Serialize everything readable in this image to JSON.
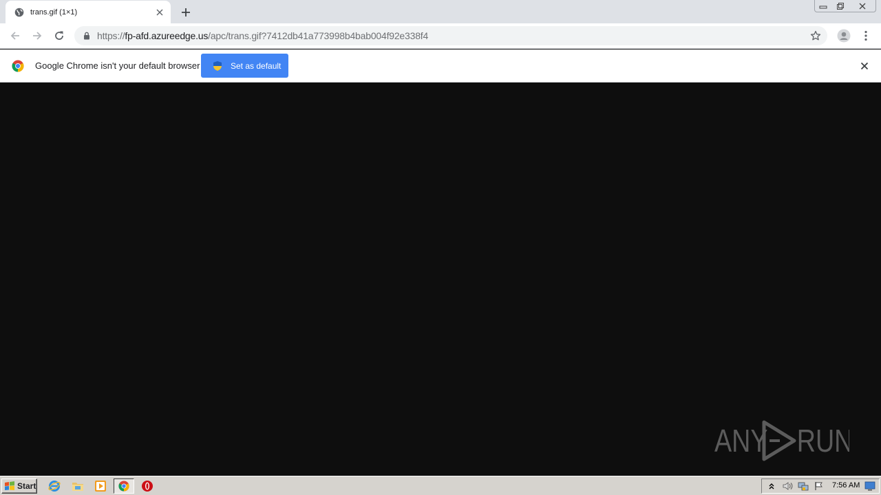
{
  "browser": {
    "tab": {
      "title": "trans.gif (1×1)",
      "favicon": "globe-icon"
    },
    "address_bar": {
      "url_prefix": "https://",
      "url_host": "fp-afd.azureedge.us",
      "url_path": "/apc/trans.gif?7412db41a773998b4bab004f92e338f4"
    },
    "infobar": {
      "message": "Google Chrome isn't your default browser",
      "button_label": "Set as default"
    }
  },
  "content": {
    "background": "#0e0e0e",
    "watermark": "ANY RUN"
  },
  "taskbar": {
    "start_label": "Start",
    "apps": [
      "internet-explorer-icon",
      "file-explorer-icon",
      "media-player-icon",
      "chrome-icon",
      "opera-icon"
    ],
    "clock": "7:56 AM"
  },
  "colors": {
    "accent": "#4285f4",
    "tabstrip": "#dee1e6",
    "taskbar": "#d6d3ce"
  }
}
